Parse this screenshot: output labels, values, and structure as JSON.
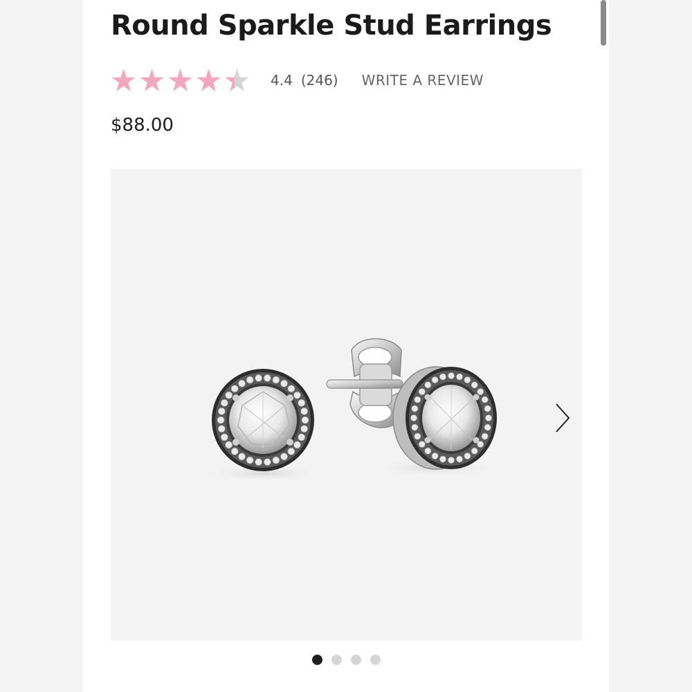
{
  "product": {
    "title": "Round Sparkle Stud Earrings",
    "price": "$88.00"
  },
  "rating": {
    "value": "4.4",
    "count": "(246)",
    "value_numeric": 4.4,
    "max_stars": 5,
    "write_review_label": "WRITE A REVIEW"
  },
  "gallery": {
    "current_slide": 1,
    "total_slides": 4,
    "next_icon": "chevron-right-icon",
    "image": "earrings-product-photo"
  },
  "colors": {
    "star_fill": "#f2a7bd",
    "star_empty": "#d4d4d4",
    "text_primary": "#1b1b1b",
    "text_muted": "#555555",
    "gallery_bg": "#f3f3f3",
    "dot_active": "#1f1f1f",
    "dot_inactive": "#d6d6d6"
  }
}
